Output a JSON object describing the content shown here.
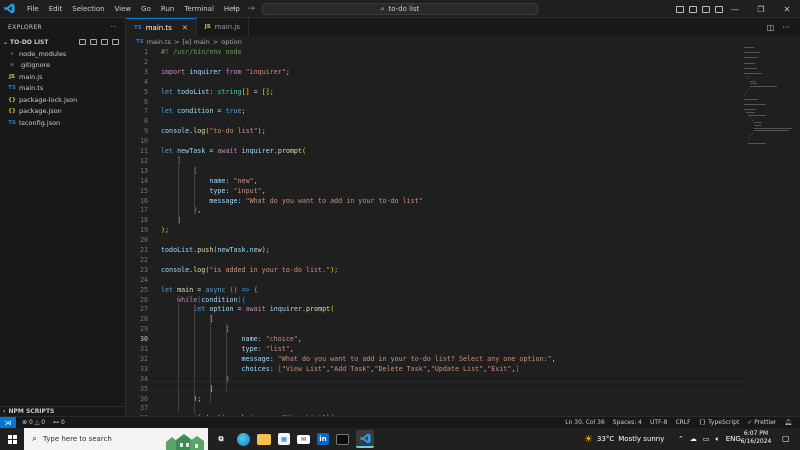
{
  "menu": [
    "File",
    "Edit",
    "Selection",
    "View",
    "Go",
    "Run",
    "Terminal",
    "Help"
  ],
  "search": {
    "text": "to-do list"
  },
  "sidebar": {
    "title": "EXPLORER",
    "folder": "TO-DO LIST",
    "items": [
      {
        "name": "node_modules",
        "icon": "chevron-right-icon",
        "glyph": "›",
        "color": "#cccccc"
      },
      {
        "name": ".gitignore",
        "icon": "git-icon",
        "glyph": "◆",
        "color": "#41535b"
      },
      {
        "name": "main.js",
        "icon": "js-file-icon",
        "glyph": "JS",
        "color": "#cbcb41"
      },
      {
        "name": "main.ts",
        "icon": "ts-file-icon",
        "glyph": "TS",
        "color": "#3178c6"
      },
      {
        "name": "package-lock.json",
        "icon": "json-file-icon",
        "glyph": "{}",
        "color": "#cbcb41"
      },
      {
        "name": "package.json",
        "icon": "json-file-icon",
        "glyph": "{}",
        "color": "#cbcb41"
      },
      {
        "name": "tsconfig.json",
        "icon": "tsconfig-icon",
        "glyph": "TS",
        "color": "#3178c6"
      }
    ],
    "npm_scripts": "NPM SCRIPTS"
  },
  "tabs": [
    {
      "label": "main.ts",
      "badge": "TS",
      "active": true
    },
    {
      "label": "main.js",
      "badge": "JS",
      "active": false
    }
  ],
  "breadcrumb": {
    "file": "main.ts",
    "symbol": "[e] main",
    "prop": "option",
    "sep": ">"
  },
  "editor": {
    "current_line": 30,
    "lines": [
      [
        [
          1,
          "c",
          "#! /usr/bin/env node"
        ]
      ],
      [],
      [
        [
          1,
          "k",
          "import"
        ],
        [
          0,
          "",
          " "
        ],
        [
          0,
          "v",
          "inquirer"
        ],
        [
          0,
          "",
          " "
        ],
        [
          0,
          "k",
          "from"
        ],
        [
          0,
          "",
          " "
        ],
        [
          0,
          "s",
          "\"inquirer\""
        ],
        [
          0,
          "",
          ";"
        ]
      ],
      [],
      [
        [
          0,
          "kb",
          "let"
        ],
        [
          0,
          "",
          " "
        ],
        [
          0,
          "v",
          "todoList"
        ],
        [
          0,
          "",
          ": "
        ],
        [
          0,
          "t",
          "string"
        ],
        [
          0,
          "p",
          "[]"
        ],
        [
          0,
          "",
          " = "
        ],
        [
          0,
          "p",
          "[]"
        ],
        [
          0,
          "",
          ";"
        ]
      ],
      [],
      [
        [
          0,
          "kb",
          "let"
        ],
        [
          0,
          "",
          " "
        ],
        [
          0,
          "v",
          "condition"
        ],
        [
          0,
          "",
          " = "
        ],
        [
          0,
          "kb",
          "true"
        ],
        [
          0,
          "",
          ";"
        ]
      ],
      [],
      [
        [
          0,
          "v",
          "console"
        ],
        [
          0,
          "",
          "."
        ],
        [
          0,
          "f",
          "log"
        ],
        [
          0,
          "p",
          "("
        ],
        [
          0,
          "s",
          "\"to-do list\""
        ],
        [
          0,
          "p",
          ")"
        ],
        [
          0,
          "",
          ";"
        ]
      ],
      [],
      [
        [
          0,
          "kb",
          "let"
        ],
        [
          0,
          "",
          " "
        ],
        [
          0,
          "v",
          "newTask"
        ],
        [
          0,
          "",
          " = "
        ],
        [
          0,
          "k",
          "await"
        ],
        [
          0,
          "",
          " "
        ],
        [
          0,
          "v",
          "inquirer"
        ],
        [
          0,
          "",
          "."
        ],
        [
          0,
          "f",
          "prompt"
        ],
        [
          0,
          "p",
          "("
        ]
      ],
      [
        [
          0,
          "",
          "    "
        ],
        [
          0,
          "pp",
          "["
        ]
      ],
      [
        [
          0,
          "",
          "        "
        ],
        [
          0,
          "pb",
          "{"
        ]
      ],
      [
        [
          0,
          "",
          "            "
        ],
        [
          0,
          "v",
          "name"
        ],
        [
          0,
          "",
          ": "
        ],
        [
          0,
          "s",
          "\"new\""
        ],
        [
          0,
          "",
          ","
        ]
      ],
      [
        [
          0,
          "",
          "            "
        ],
        [
          0,
          "v",
          "type"
        ],
        [
          0,
          "",
          ": "
        ],
        [
          0,
          "s",
          "\"input\""
        ],
        [
          0,
          "",
          ","
        ]
      ],
      [
        [
          0,
          "",
          "            "
        ],
        [
          0,
          "v",
          "message"
        ],
        [
          0,
          "",
          ": "
        ],
        [
          0,
          "s",
          "\"What do you want to add in your to-do list\""
        ]
      ],
      [
        [
          0,
          "",
          "        "
        ],
        [
          0,
          "pb",
          "}"
        ],
        [
          0,
          "",
          ","
        ]
      ],
      [
        [
          0,
          "",
          "    "
        ],
        [
          0,
          "pp",
          "]"
        ]
      ],
      [
        [
          0,
          "p",
          ")"
        ],
        [
          0,
          "",
          ";"
        ]
      ],
      [],
      [
        [
          0,
          "v",
          "todoList"
        ],
        [
          0,
          "",
          "."
        ],
        [
          0,
          "f",
          "push"
        ],
        [
          0,
          "p",
          "("
        ],
        [
          0,
          "v",
          "newTask"
        ],
        [
          0,
          "",
          "."
        ],
        [
          0,
          "v",
          "new"
        ],
        [
          0,
          "p",
          ")"
        ],
        [
          0,
          "",
          ";"
        ]
      ],
      [],
      [
        [
          0,
          "v",
          "console"
        ],
        [
          0,
          "",
          "."
        ],
        [
          0,
          "f",
          "log"
        ],
        [
          0,
          "p",
          "("
        ],
        [
          0,
          "s",
          "\"is added in your to-do list.\""
        ],
        [
          0,
          "p",
          ")"
        ],
        [
          0,
          "",
          ";"
        ]
      ],
      [],
      [
        [
          0,
          "kb",
          "let"
        ],
        [
          0,
          "",
          " "
        ],
        [
          0,
          "f",
          "main"
        ],
        [
          0,
          "",
          " = "
        ],
        [
          0,
          "kb",
          "async"
        ],
        [
          0,
          "",
          " "
        ],
        [
          0,
          "pp",
          "()"
        ],
        [
          0,
          "",
          " "
        ],
        [
          0,
          "kb",
          "=>"
        ],
        [
          0,
          "",
          " "
        ],
        [
          0,
          "pp",
          "{"
        ]
      ],
      [
        [
          0,
          "",
          "    "
        ],
        [
          0,
          "k",
          "while"
        ],
        [
          0,
          "pb",
          "("
        ],
        [
          0,
          "v",
          "condition"
        ],
        [
          0,
          "pb",
          ")"
        ],
        [
          0,
          "pb",
          "{"
        ]
      ],
      [
        [
          0,
          "",
          "        "
        ],
        [
          0,
          "kb",
          "let"
        ],
        [
          0,
          "",
          " "
        ],
        [
          0,
          "v",
          "option"
        ],
        [
          0,
          "",
          " = "
        ],
        [
          0,
          "k",
          "await"
        ],
        [
          0,
          "",
          " "
        ],
        [
          0,
          "v",
          "inquirer"
        ],
        [
          0,
          "",
          "."
        ],
        [
          0,
          "f",
          "prompt"
        ],
        [
          0,
          "p",
          "("
        ]
      ],
      [
        [
          0,
          "",
          "            "
        ],
        [
          0,
          "p",
          "["
        ]
      ],
      [
        [
          0,
          "",
          "                "
        ],
        [
          0,
          "pp",
          "{"
        ]
      ],
      [
        [
          0,
          "",
          "                    "
        ],
        [
          0,
          "v",
          "name"
        ],
        [
          0,
          "",
          ": "
        ],
        [
          0,
          "s",
          "\"choice\""
        ],
        [
          0,
          "",
          ","
        ]
      ],
      [
        [
          0,
          "",
          "                    "
        ],
        [
          0,
          "v",
          "type"
        ],
        [
          0,
          "",
          ": "
        ],
        [
          0,
          "s",
          "\"list\""
        ],
        [
          0,
          "",
          ","
        ]
      ],
      [
        [
          0,
          "",
          "                    "
        ],
        [
          0,
          "v",
          "message"
        ],
        [
          0,
          "",
          ": "
        ],
        [
          0,
          "s",
          "\"What do you want to add in your to-do list? Select any one option:\""
        ],
        [
          0,
          "",
          ","
        ]
      ],
      [
        [
          0,
          "",
          "                    "
        ],
        [
          0,
          "v",
          "choices"
        ],
        [
          0,
          "",
          ": "
        ],
        [
          0,
          "pb",
          "["
        ],
        [
          0,
          "s",
          "\"View List\""
        ],
        [
          0,
          "",
          ","
        ],
        [
          0,
          "s",
          "\"Add Task\""
        ],
        [
          0,
          "",
          ","
        ],
        [
          0,
          "s",
          "\"Delete Task\""
        ],
        [
          0,
          "",
          ","
        ],
        [
          0,
          "s",
          "\"Update List\""
        ],
        [
          0,
          "",
          ","
        ],
        [
          0,
          "s",
          "\"Exit\""
        ],
        [
          0,
          "",
          ","
        ],
        [
          0,
          "pb",
          "]"
        ]
      ],
      [
        [
          0,
          "",
          "                "
        ],
        [
          0,
          "pp",
          "}"
        ]
      ],
      [
        [
          0,
          "",
          "            "
        ],
        [
          0,
          "p",
          "]"
        ]
      ],
      [
        [
          0,
          "",
          "        "
        ],
        [
          0,
          "p",
          ")"
        ],
        [
          0,
          "",
          ";"
        ]
      ],
      [],
      [
        [
          0,
          "",
          "        "
        ],
        [
          0,
          "k",
          "if"
        ],
        [
          0,
          "",
          " "
        ],
        [
          0,
          "p",
          "("
        ],
        [
          0,
          "v",
          "option"
        ],
        [
          0,
          "",
          "."
        ],
        [
          0,
          "v",
          "choice"
        ],
        [
          0,
          "",
          " === "
        ],
        [
          0,
          "s",
          "\"View List\""
        ],
        [
          0,
          "p",
          ")"
        ],
        [
          0,
          "pb",
          "{"
        ]
      ]
    ]
  },
  "status": {
    "errors": "0",
    "warnings": "0",
    "ports": "0",
    "cursor": "Ln 30, Col 36",
    "spaces": "Spaces: 4",
    "encoding": "UTF-8",
    "eol": "CRLF",
    "language": "TypeScript",
    "formatter": "Prettier"
  },
  "taskbar": {
    "search_placeholder": "Type here to search",
    "weather_temp": "33°C",
    "weather_desc": "Mostly sunny",
    "tray_lang": "ENG",
    "time": "6:07 PM",
    "date": "6/16/2024"
  },
  "colors": {
    "accent": "#0078d4",
    "editor_bg": "#1f1f1f",
    "sidebar_bg": "#181818"
  }
}
